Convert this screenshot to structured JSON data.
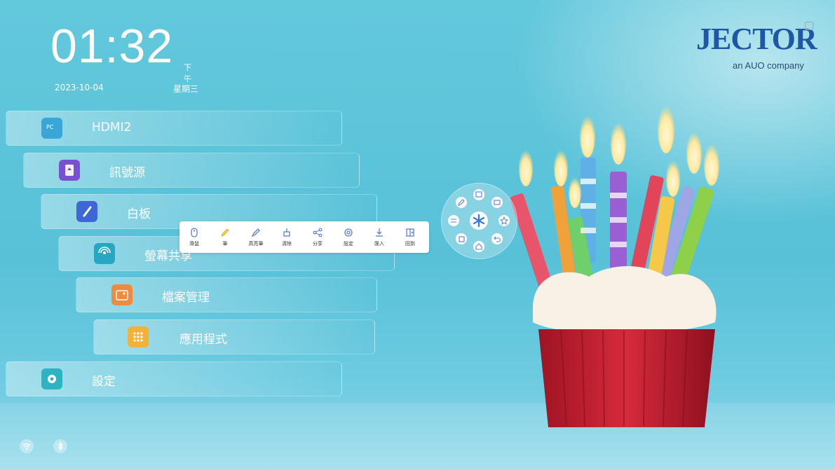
{
  "clock": {
    "time": "01:32",
    "ampm": "下午",
    "date": "2023-10-04",
    "weekday": "星期三"
  },
  "brand": {
    "name": "JECTOR",
    "tagline": "an AUO company"
  },
  "menu": [
    {
      "label": "HDMI2",
      "icon": "pc-icon",
      "icon_text": "PC",
      "color": "#3aa6d8"
    },
    {
      "label": "訊號源",
      "icon": "source-icon",
      "color": "#7a4fd1"
    },
    {
      "label": "白板",
      "icon": "whiteboard-icon",
      "color": "#3e66d6"
    },
    {
      "label": "螢幕共享",
      "icon": "screen-share-icon",
      "color": "#27a7c4"
    },
    {
      "label": "檔案管理",
      "icon": "folder-icon",
      "color": "#f08a3c"
    },
    {
      "label": "應用程式",
      "icon": "apps-icon",
      "color": "#f2b23a"
    },
    {
      "label": "設定",
      "icon": "settings-icon",
      "color": "#2fb3c2"
    }
  ],
  "toolbar": [
    {
      "label": "滑鼠",
      "icon": "mouse-icon"
    },
    {
      "label": "筆",
      "icon": "pen-icon"
    },
    {
      "label": "高亮筆",
      "icon": "highlighter-icon"
    },
    {
      "label": "清除",
      "icon": "eraser-icon"
    },
    {
      "label": "分享",
      "icon": "share-icon"
    },
    {
      "label": "設定",
      "icon": "gear-icon"
    },
    {
      "label": "匯入",
      "icon": "import-icon"
    },
    {
      "label": "回到",
      "icon": "exit-icon"
    }
  ],
  "wheel": {
    "buttons": [
      "pen-icon",
      "window-icon",
      "screen-icon",
      "settings-sliders-icon",
      "star-icon",
      "copy-icon",
      "home-icon",
      "back-icon"
    ],
    "center": "asterisk-icon"
  },
  "status": {
    "icons": [
      "wifi-icon",
      "bluetooth-icon"
    ]
  }
}
